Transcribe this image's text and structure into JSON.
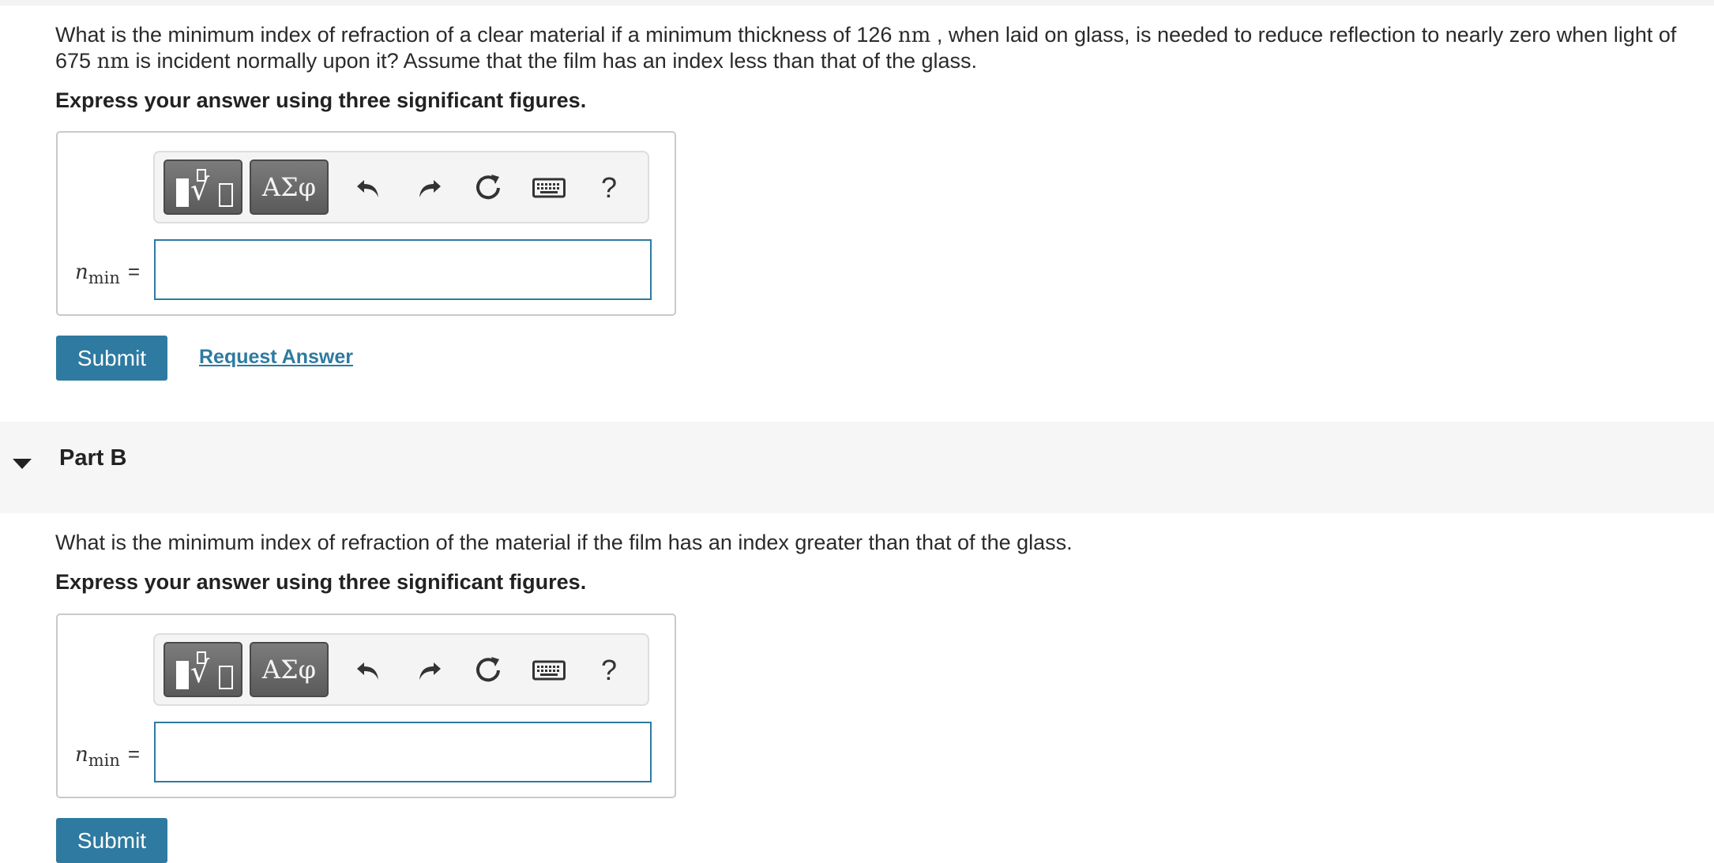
{
  "partA": {
    "question": {
      "t1": "What is the minimum index of refraction of a clear material if a minimum thickness of 126 ",
      "u1": "nm",
      "t2": " , when laid on glass, is needed to reduce reflection to nearly zero when light of 675 ",
      "u2": "nm",
      "t3": " is incident normally upon it? Assume that the film has an index less than that of the glass."
    },
    "instruction": "Express your answer using three significant figures.",
    "variable": "n",
    "subscript": "min",
    "equals": "=",
    "input_value": "",
    "submit_label": "Submit",
    "request_label": "Request Answer"
  },
  "partB": {
    "title": "Part B",
    "question": "What is the minimum index of refraction of the material if the film has an index greater than that of the glass.",
    "instruction": "Express your answer using three significant figures.",
    "variable": "n",
    "subscript": "min",
    "equals": "=",
    "input_value": ""
  },
  "toolbar": {
    "greek_label": "ΑΣφ",
    "help_label": "?",
    "icons": [
      "templates-icon",
      "greek-letters-icon",
      "undo-icon",
      "redo-icon",
      "reset-icon",
      "keyboard-icon",
      "help-icon"
    ]
  },
  "colors": {
    "accent": "#2e7aa0",
    "toolbar_button": "#6b6b6b",
    "box_border": "#c9c9c9",
    "section_bg": "#f6f6f6"
  }
}
